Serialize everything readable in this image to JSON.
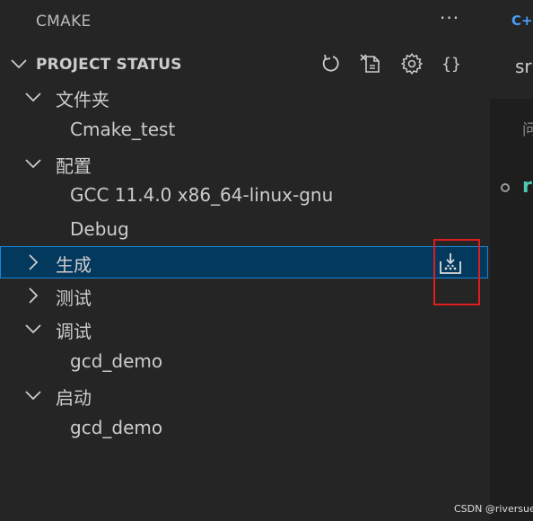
{
  "sidebar": {
    "title": "CMAKE",
    "more_label": "···",
    "section": {
      "title": "PROJECT STATUS",
      "toolbar_icons": [
        "refresh-icon",
        "clear-all-icon",
        "gear-icon",
        "braces-icon"
      ],
      "braces_label": "{}"
    },
    "tree": [
      {
        "label": "文件夹",
        "level": 0,
        "expanded": true
      },
      {
        "label": "Cmake_test",
        "level": 1
      },
      {
        "label": "配置",
        "level": 0,
        "expanded": true
      },
      {
        "label": "GCC 11.4.0 x86_64-linux-gnu",
        "level": 1
      },
      {
        "label": "Debug",
        "level": 1
      },
      {
        "label": "生成",
        "level": 0,
        "expanded": false,
        "selected": true,
        "action_icon": "build-icon"
      },
      {
        "label": "测试",
        "level": 0,
        "expanded": false
      },
      {
        "label": "调试",
        "level": 0,
        "expanded": true
      },
      {
        "label": "gcd_demo",
        "level": 1
      },
      {
        "label": "启动",
        "level": 0,
        "expanded": true
      },
      {
        "label": "gcd_demo",
        "level": 1
      }
    ]
  },
  "editor": {
    "tab_icon": "C+",
    "tab_text": "sr",
    "panel_label": "问",
    "code_char": "r"
  },
  "watermark": "CSDN @riversuer",
  "colors": {
    "sidebar_bg": "#252526",
    "editor_bg": "#1e1e1e",
    "selection_bg": "#04395e",
    "selection_border": "#1a85d6",
    "annotation_red": "#e01c1c",
    "text": "#cccccc"
  }
}
